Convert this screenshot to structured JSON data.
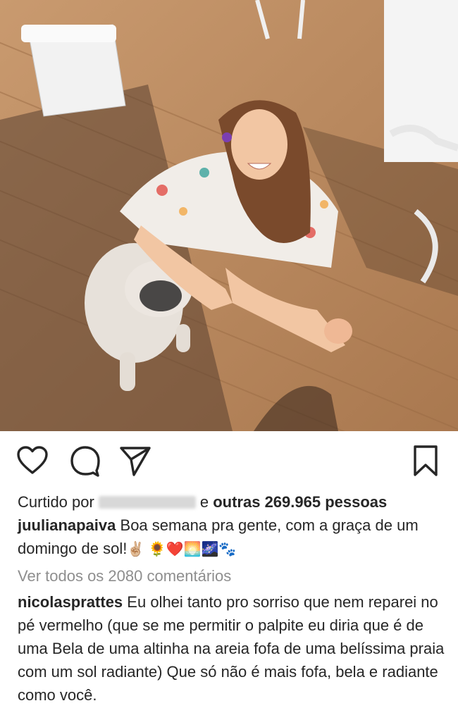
{
  "post": {
    "photo_alt": "photo",
    "likes": {
      "prefix": "Curtido por",
      "connector": "e",
      "others": "outras 269.965 pessoas"
    },
    "caption": {
      "username": "juulianapaiva",
      "text": "Boa semana pra gente, com a graça de um domingo de sol!",
      "emojis": "✌🏼 🌻❤️🌅🌌🐾"
    },
    "view_all_comments": "Ver todos os 2080 comentários",
    "comment": {
      "username": "nicolasprattes",
      "text": "Eu olhei tanto pro sorriso que nem reparei no pé vermelho (que se me permitir o palpite eu diria que é de uma Bela de uma altinha na areia fofa de uma belíssima praia com um sol radiante) Que só não é mais fofa, bela e radiante como você."
    }
  },
  "icons": {
    "like": "heart-icon",
    "comment": "comment-icon",
    "share": "send-icon",
    "save": "bookmark-icon"
  }
}
